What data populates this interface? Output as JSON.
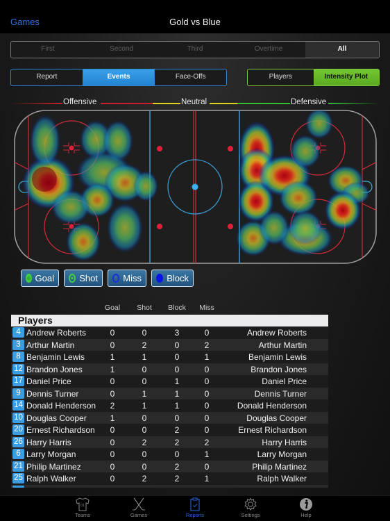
{
  "nav": {
    "back_label": "Games",
    "title": "Gold vs Blue"
  },
  "periods": {
    "items": [
      "First",
      "Second",
      "Third",
      "Overtime",
      "All"
    ],
    "selected": "All"
  },
  "views": {
    "items": [
      "Report",
      "Events",
      "Face-Offs"
    ],
    "selected": "Events"
  },
  "modes": {
    "items": [
      "Players",
      "Intensity Plot"
    ],
    "selected": "Intensity Plot"
  },
  "zones": {
    "offensive": "Offensive",
    "neutral": "Neutral",
    "defensive": "Defensive",
    "colors": {
      "offensive": "#c8202a",
      "neutral": "#e0d020",
      "defensive": "#30c030"
    }
  },
  "rink": {
    "colors": {
      "board": "#9a9a9a",
      "red_line": "#d42a3a",
      "blue_line": "#3a9ad0",
      "ice": "#1e1e1e"
    },
    "heat_spots": [
      {
        "zone": "left-goal-crease",
        "intensity": 1.0
      },
      {
        "zone": "left-top-faceoff-slot",
        "intensity": 0.45
      },
      {
        "zone": "left-top-circle-right",
        "intensity": 0.45
      },
      {
        "zone": "left-low-slot",
        "intensity": 0.55
      },
      {
        "zone": "left-bottom-circle",
        "intensity": 0.7
      },
      {
        "zone": "left-point-middle",
        "intensity": 0.7
      },
      {
        "zone": "left-blueline-middle",
        "intensity": 0.7
      },
      {
        "zone": "left-blueline-low",
        "intensity": 0.5
      },
      {
        "zone": "right-blueline-top",
        "intensity": 0.95
      },
      {
        "zone": "right-blueline-mid",
        "intensity": 0.95
      },
      {
        "zone": "right-blueline-low",
        "intensity": 0.9
      },
      {
        "zone": "right-blueline-bottom",
        "intensity": 0.75
      },
      {
        "zone": "right-slot",
        "intensity": 0.85
      },
      {
        "zone": "right-slot-low",
        "intensity": 0.8
      },
      {
        "zone": "right-crease-top",
        "intensity": 0.7
      },
      {
        "zone": "right-bottom-circle-right",
        "intensity": 0.8
      },
      {
        "zone": "right-bottom-circle",
        "intensity": 0.75
      },
      {
        "zone": "right-top-circle",
        "intensity": 0.5
      }
    ]
  },
  "legend": [
    {
      "label": "Goal",
      "icon": "goal-dot-icon",
      "color": "#3cc43c",
      "style": "filled-ring"
    },
    {
      "label": "Shot",
      "icon": "shot-ring-icon",
      "color": "#3cc43c",
      "style": "ring"
    },
    {
      "label": "Miss",
      "icon": "miss-ring-icon",
      "color": "#1a2fd8",
      "style": "ring"
    },
    {
      "label": "Block",
      "icon": "block-dot-icon",
      "color": "#0a14e8",
      "style": "filled"
    }
  ],
  "table": {
    "columns": [
      "Goal",
      "Shot",
      "Block",
      "Miss"
    ],
    "section_title": "Players",
    "rows": [
      {
        "number": "4",
        "name": "Andrew Roberts",
        "goal": "0",
        "shot": "0",
        "block": "3",
        "miss": "0"
      },
      {
        "number": "3",
        "name": "Arthur Martin",
        "goal": "0",
        "shot": "2",
        "block": "0",
        "miss": "2"
      },
      {
        "number": "8",
        "name": "Benjamin Lewis",
        "goal": "1",
        "shot": "1",
        "block": "0",
        "miss": "1"
      },
      {
        "number": "12",
        "name": "Brandon Jones",
        "goal": "1",
        "shot": "0",
        "block": "0",
        "miss": "0"
      },
      {
        "number": "17",
        "name": "Daniel Price",
        "goal": "0",
        "shot": "0",
        "block": "1",
        "miss": "0"
      },
      {
        "number": "9",
        "name": "Dennis Turner",
        "goal": "0",
        "shot": "1",
        "block": "1",
        "miss": "0"
      },
      {
        "number": "14",
        "name": "Donald Henderson",
        "goal": "2",
        "shot": "1",
        "block": "1",
        "miss": "0"
      },
      {
        "number": "10",
        "name": "Douglas Cooper",
        "goal": "1",
        "shot": "0",
        "block": "0",
        "miss": "0"
      },
      {
        "number": "20",
        "name": "Ernest Richardson",
        "goal": "0",
        "shot": "0",
        "block": "2",
        "miss": "0"
      },
      {
        "number": "26",
        "name": "Harry Harris",
        "goal": "0",
        "shot": "2",
        "block": "2",
        "miss": "2"
      },
      {
        "number": "6",
        "name": "Larry Morgan",
        "goal": "0",
        "shot": "0",
        "block": "0",
        "miss": "1"
      },
      {
        "number": "21",
        "name": "Philip Martinez",
        "goal": "0",
        "shot": "0",
        "block": "2",
        "miss": "0"
      },
      {
        "number": "25",
        "name": "Ralph Walker",
        "goal": "0",
        "shot": "2",
        "block": "2",
        "miss": "1"
      }
    ]
  },
  "tabbar": {
    "items": [
      {
        "label": "Teams",
        "icon": "jersey-icon",
        "jersey_number": "01"
      },
      {
        "label": "Games",
        "icon": "hockey-sticks-icon"
      },
      {
        "label": "Reports",
        "icon": "clipboard-icon"
      },
      {
        "label": "Settings",
        "icon": "gear-icon"
      },
      {
        "label": "Help",
        "icon": "info-icon"
      }
    ],
    "selected": "Reports",
    "accent": "#2763d6"
  }
}
